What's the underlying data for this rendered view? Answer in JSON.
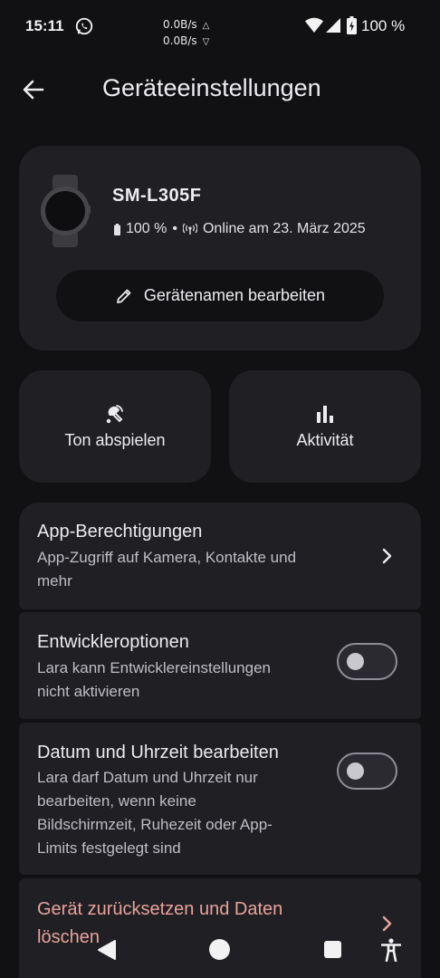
{
  "status_bar": {
    "time": "15:11",
    "net_up": "0.0B/s",
    "net_down": "0.0B/s",
    "up_arrow": "△",
    "down_arrow": "▽",
    "battery": "100 %"
  },
  "header": {
    "title": "Geräteeinstellungen"
  },
  "device": {
    "name": "SM-L305F",
    "battery": "100 %",
    "separator": "•",
    "online_status": "Online am 23. März 2025",
    "edit_label": "Gerätenamen bearbeiten"
  },
  "actions": {
    "play_sound": "Ton abspielen",
    "activity": "Aktivität"
  },
  "settings": {
    "permissions": {
      "title": "App-Berechtigungen",
      "desc_line1": "App-Zugriff auf Kamera, Kontakte und",
      "desc_line2": "mehr"
    },
    "developer": {
      "title": "Entwickleroptionen",
      "desc_line1": "Lara kann Entwicklereinstellungen",
      "desc_line2": "nicht aktivieren",
      "enabled": false
    },
    "datetime": {
      "title": "Datum und Uhrzeit bearbeiten",
      "desc_line1": "Lara darf Datum und Uhrzeit nur",
      "desc_line2": "bearbeiten, wenn keine",
      "desc_line3": "Bildschirmzeit, Ruhezeit oder App-",
      "desc_line4": "Limits festgelegt sind",
      "enabled": false
    },
    "reset": {
      "title_line1": "Gerät zurücksetzen und Daten",
      "title_line2": "löschen",
      "color": "#e8a29a"
    }
  },
  "icons": {
    "back": "arrow-left",
    "play_sound": "speaker-locate",
    "activity": "bar-chart",
    "edit": "pencil",
    "chevron": "chevron-right"
  }
}
